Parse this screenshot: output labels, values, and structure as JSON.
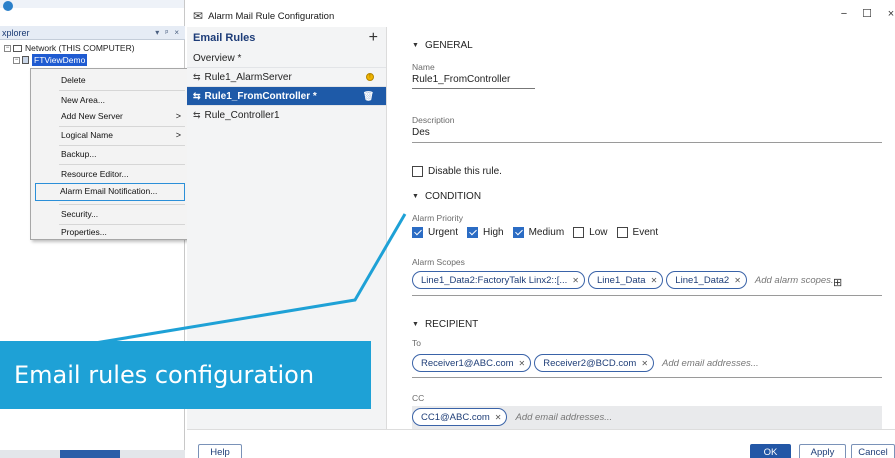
{
  "explorer": {
    "title": "xplorer",
    "title_icons": [
      "▾",
      "ᵖ",
      "×"
    ],
    "tree": [
      {
        "label": "Network (THIS COMPUTER)",
        "expander": "−"
      },
      {
        "label": "FTViewDemo",
        "expander": "−",
        "selected": true
      }
    ]
  },
  "context_menu": {
    "items": [
      {
        "label": "Delete",
        "submenu": false
      },
      {
        "label": "New Area...",
        "submenu": false
      },
      {
        "label": "Add New Server",
        "submenu": true
      },
      {
        "label": "Logical Name",
        "submenu": true
      },
      {
        "label": "Backup...",
        "submenu": false
      },
      {
        "label": "Resource Editor...",
        "submenu": false
      },
      {
        "label": "Alarm Email Notification...",
        "submenu": false,
        "focused": true
      },
      {
        "label": "Security...",
        "submenu": false
      },
      {
        "label": "Properties...",
        "submenu": false
      }
    ],
    "submenu_arrow": ">"
  },
  "dialog": {
    "title": "Alarm Mail Rule Configuration",
    "window_buttons": {
      "minimize": "−",
      "maximize": "☐",
      "close": "×"
    },
    "rules_panel": {
      "header": "Email Rules",
      "add_glyph": "+",
      "overview": "Overview *",
      "rules": [
        {
          "name": "Rule1_AlarmServer",
          "state": "warning"
        },
        {
          "name": "Rule1_FromController *",
          "state": "selected"
        },
        {
          "name": "Rule_Controller1",
          "state": "normal"
        }
      ]
    },
    "general": {
      "section": "GENERAL",
      "name_label": "Name",
      "name_value": "Rule1_FromController",
      "description_label": "Description",
      "description_value": "Des",
      "disable_label": "Disable this rule.",
      "disabled": false
    },
    "condition": {
      "section": "CONDITION",
      "priority_label": "Alarm Priority",
      "priorities": [
        {
          "label": "Urgent",
          "checked": true
        },
        {
          "label": "High",
          "checked": true
        },
        {
          "label": "Medium",
          "checked": true
        },
        {
          "label": "Low",
          "checked": false
        },
        {
          "label": "Event",
          "checked": false
        }
      ],
      "scopes_label": "Alarm Scopes",
      "scopes": [
        "Line1_Data2:FactoryTalk Linx2::[...",
        "Line1_Data",
        "Line1_Data2"
      ],
      "scopes_placeholder": "Add alarm scopes..."
    },
    "recipient": {
      "section": "RECIPIENT",
      "to_label": "To",
      "to": [
        "Receiver1@ABC.com",
        "Receiver2@BCD.com"
      ],
      "to_placeholder": "Add email addresses...",
      "cc_label": "CC",
      "cc": [
        "CC1@ABC.com"
      ],
      "cc_placeholder": "Add email addresses..."
    },
    "buttons": {
      "help": "Help",
      "ok": "OK",
      "apply": "Apply",
      "cancel": "Cancel"
    }
  },
  "annotation": {
    "text": "Email rules configuration"
  },
  "colors": {
    "accent": "#1e5aa8",
    "callout": "#1ea1d6",
    "checkbox_checked": "#2b6cc4"
  }
}
